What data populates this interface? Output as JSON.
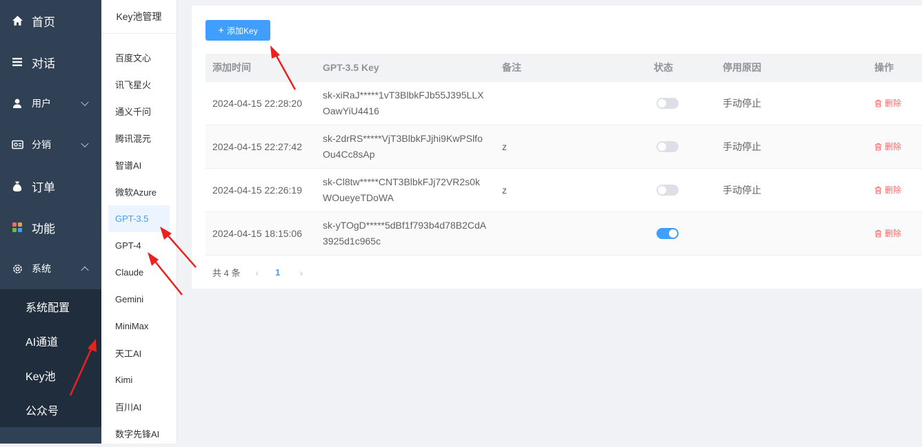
{
  "sidebar": {
    "items": [
      {
        "label": "首页",
        "icon": "home-icon"
      },
      {
        "label": "对话",
        "icon": "list-icon"
      },
      {
        "label": "用户",
        "icon": "user-icon"
      },
      {
        "label": "分销",
        "icon": "share-icon"
      },
      {
        "label": "订单",
        "icon": "money-bag-icon"
      },
      {
        "label": "功能",
        "icon": "grid-icon"
      },
      {
        "label": "系统",
        "icon": "gear-icon"
      }
    ],
    "system_submenu": [
      "系统配置",
      "AI通道",
      "Key池",
      "公众号"
    ]
  },
  "key_panel": {
    "title": "Key池管理",
    "items": [
      "百度文心",
      "讯飞星火",
      "通义千问",
      "腾讯混元",
      "智谱AI",
      "微软Azure",
      "GPT-3.5",
      "GPT-4",
      "Claude",
      "Gemini",
      "MiniMax",
      "天工AI",
      "Kimi",
      "百川AI",
      "数字先锋AI"
    ],
    "active": "GPT-3.5"
  },
  "toolbar": {
    "add_label": "添加Key"
  },
  "table": {
    "headers": {
      "time": "添加时间",
      "key": "GPT-3.5 Key",
      "note": "备注",
      "status": "状态",
      "reason": "停用原因",
      "op": "操作"
    },
    "rows": [
      {
        "time": "2024-04-15 22:28:20",
        "key": "sk-xiRaJ*****1vT3BlbkFJb55J395LLXOawYiU4416",
        "note": "",
        "enabled": false,
        "reason": "手动停止",
        "op": "删除"
      },
      {
        "time": "2024-04-15 22:27:42",
        "key": "sk-2drRS*****VjT3BlbkFJjhi9KwPSlfoOu4Cc8sAp",
        "note": "z",
        "enabled": false,
        "reason": "手动停止",
        "op": "删除"
      },
      {
        "time": "2024-04-15 22:26:19",
        "key": "sk-Cl8tw*****CNT3BlbkFJj72VR2s0kWOueyeTDoWA",
        "note": "z",
        "enabled": false,
        "reason": "手动停止",
        "op": "删除"
      },
      {
        "time": "2024-04-15 18:15:06",
        "key": "sk-yTOgD*****5dBf1f793b4d78B2CdA3925d1c965c",
        "note": "",
        "enabled": true,
        "reason": "",
        "op": "删除"
      }
    ]
  },
  "pagination": {
    "total_label": "共 4 条",
    "current": "1"
  },
  "colors": {
    "sidebar_bg": "#304156",
    "submenu_bg": "#1f2d3d",
    "accent": "#409eff",
    "danger": "#f56c6c",
    "annotation": "#e8231f"
  }
}
